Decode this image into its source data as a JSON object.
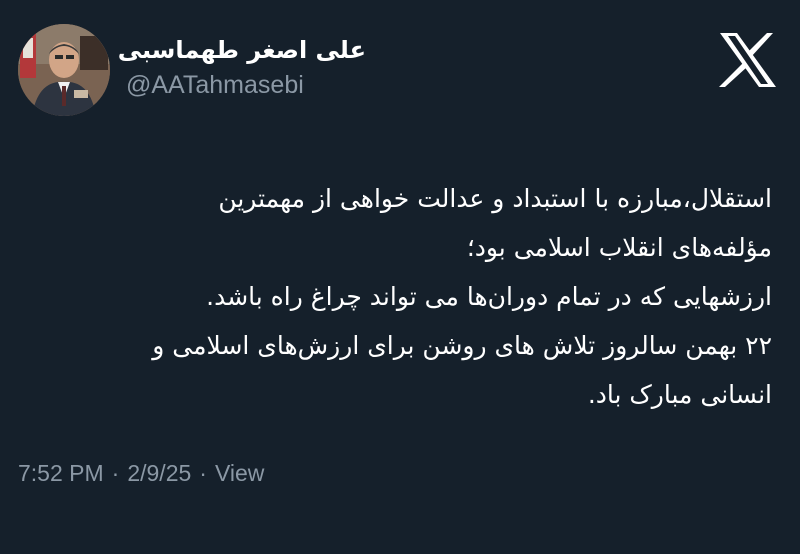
{
  "author": {
    "display_name": "علی اصغر طهماسبی",
    "handle": "@AATahmasebi"
  },
  "platform_icon": "x-logo-icon",
  "tweet": {
    "lines": [
      "استقلال،مبارزه با استبداد و عدالت خواهی از مهمترین",
      "مؤلفه‌های انقلاب اسلامی بود؛",
      "ارزشهایی که در تمام دوران‌ها می تواند چراغ راه باشد.",
      "۲۲ بهمن سالروز تلاش های روشن برای ارزش‌های اسلامی و",
      "انسانی مبارک باد."
    ]
  },
  "meta": {
    "time": "7:52 PM",
    "separator": "·",
    "date": "2/9/25",
    "view_label": "View"
  },
  "colors": {
    "background": "#15202b",
    "text_primary": "#ffffff",
    "text_secondary": "#8b98a5"
  }
}
